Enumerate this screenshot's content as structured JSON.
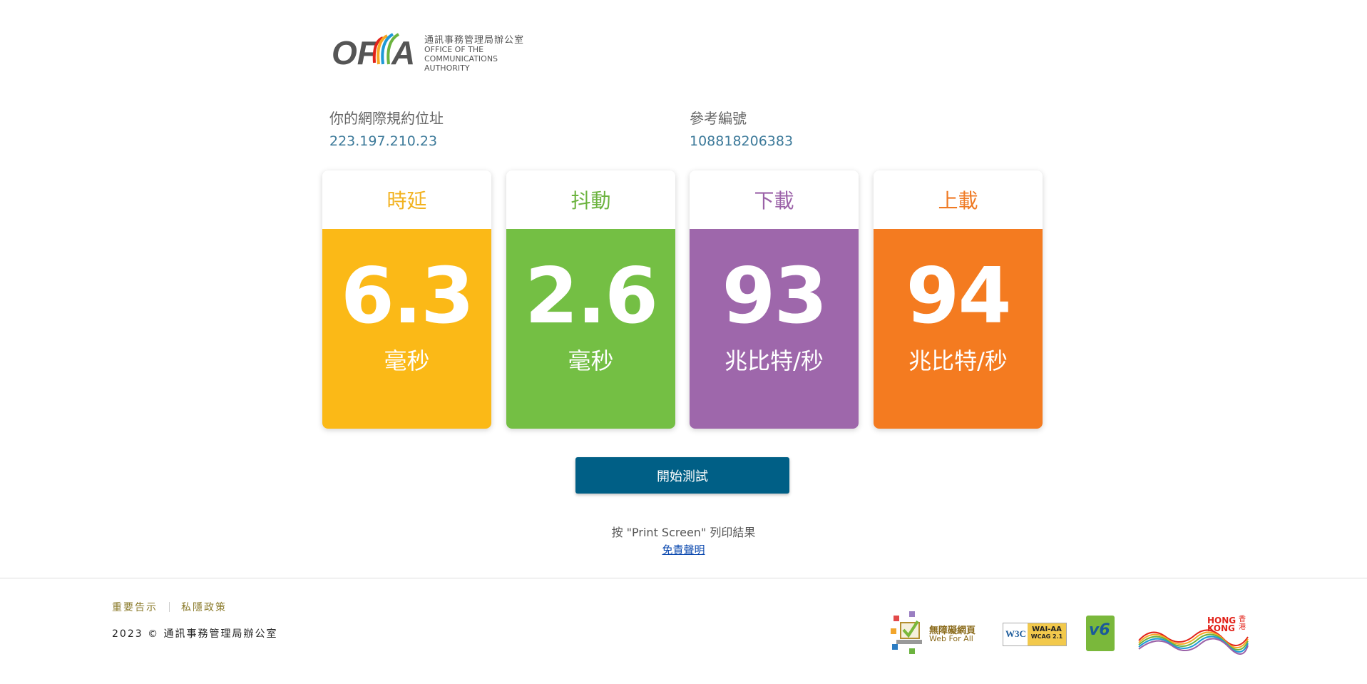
{
  "header": {
    "logo_zh": "通訊事務管理局辦公室",
    "logo_en_line1": "OFFICE OF THE",
    "logo_en_line2": "COMMUNICATIONS AUTHORITY"
  },
  "info": {
    "ip_label": "你的網際規約位址",
    "ip_value": "223.197.210.23",
    "ref_label": "參考編號",
    "ref_value": "108818206383"
  },
  "cards": [
    {
      "title": "時延",
      "value": "6.3",
      "unit": "毫秒",
      "color": "#fbb917",
      "title_color": "#f2b21f"
    },
    {
      "title": "抖動",
      "value": "2.6",
      "unit": "毫秒",
      "color": "#74bf44",
      "title_color": "#6cb33f"
    },
    {
      "title": "下載",
      "value": "93",
      "unit": "兆比特/秒",
      "color": "#9e67ab",
      "title_color": "#9b62a8"
    },
    {
      "title": "上載",
      "value": "94",
      "unit": "兆比特/秒",
      "color": "#f47b20",
      "title_color": "#ef7a24"
    }
  ],
  "actions": {
    "start_label": "開始測試",
    "hint": "按 \"Print Screen\" 列印結果",
    "disclaimer": "免責聲明"
  },
  "footer": {
    "links": [
      "重要告示",
      "私隱政策"
    ],
    "copyright": "2023 © 通訊事務管理局辦公室",
    "badge_webforall_zh": "無障礙網頁",
    "badge_webforall_en": "Web For All",
    "badge_w3c_text": "W3C",
    "badge_wai_line1": "WAI-AA",
    "badge_wai_line2": "WCAG 2.1",
    "badge_ipv6_text": "v6",
    "badge_hk_text": "HONG KONG",
    "badge_hk_zh": "香港"
  }
}
